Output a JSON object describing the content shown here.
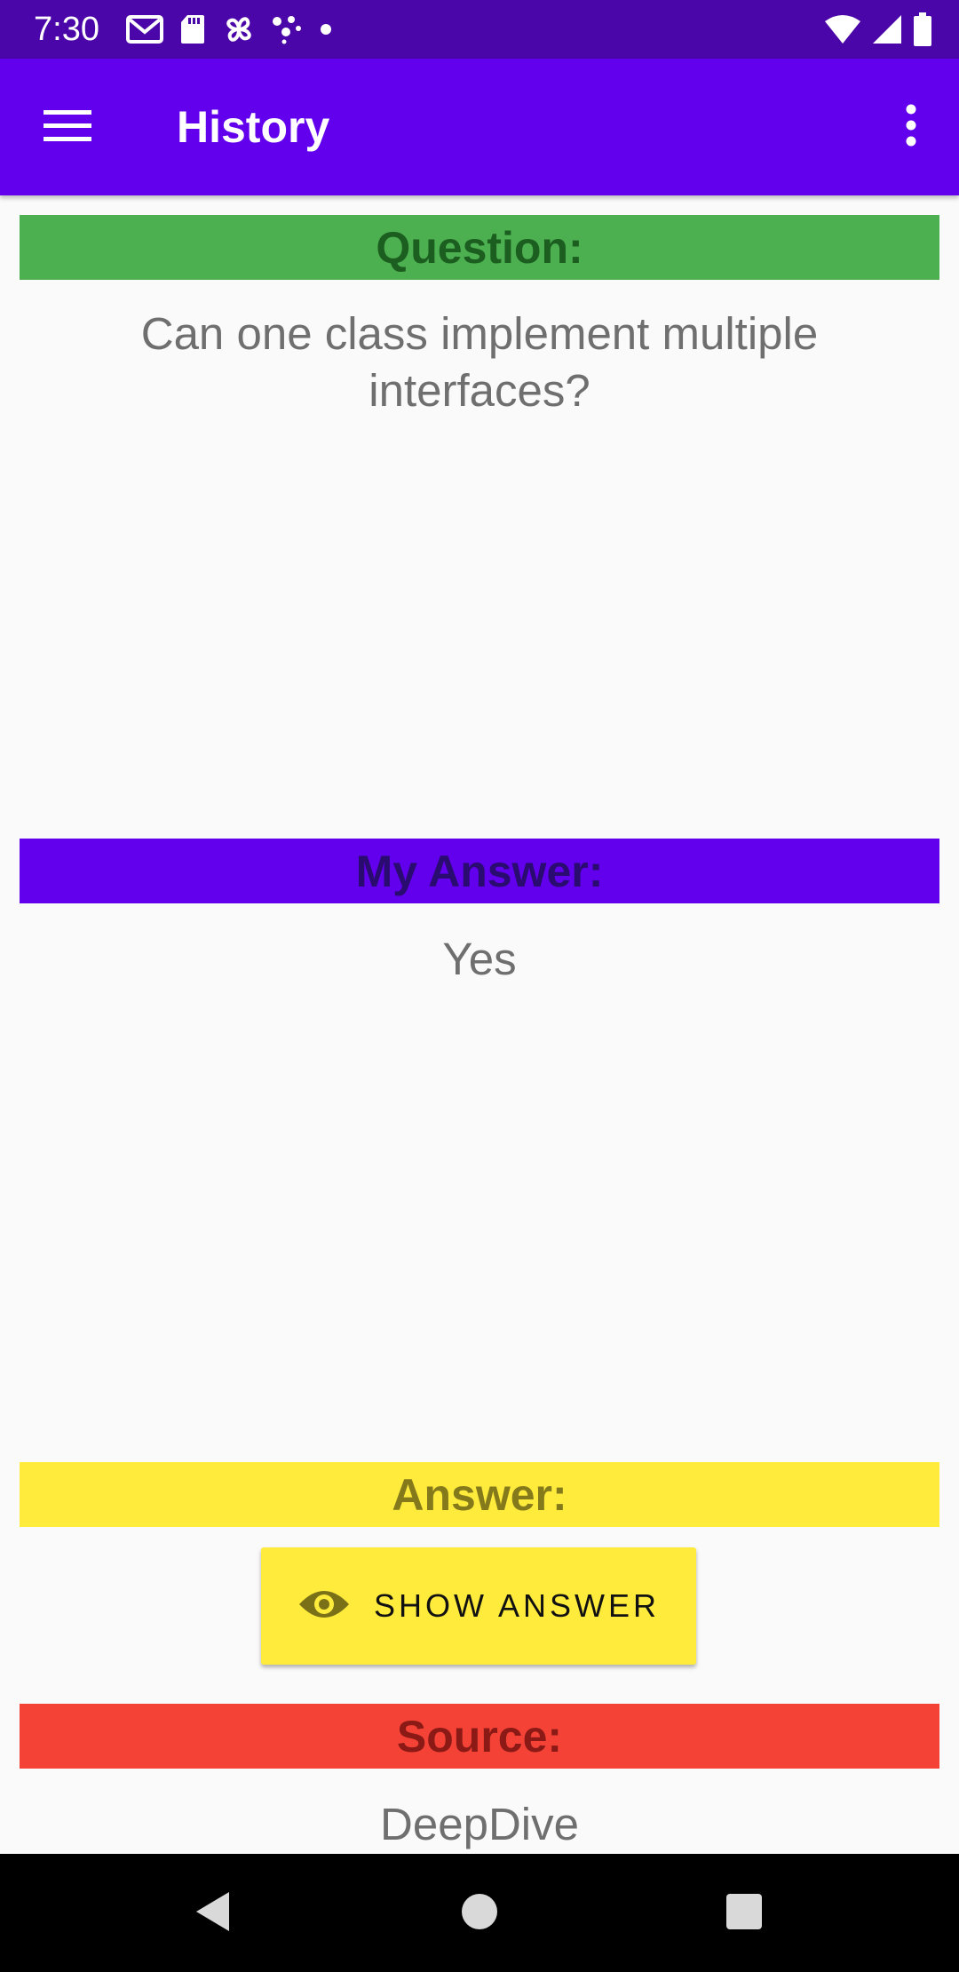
{
  "status_bar": {
    "time": "7:30",
    "left_icons": [
      "gmail-icon",
      "sd-card-icon",
      "pinwheel-icon",
      "dots-app-icon",
      "notification-dot-icon"
    ],
    "right_icons": [
      "wifi-icon",
      "signal-icon",
      "battery-icon"
    ]
  },
  "app_bar": {
    "title": "History",
    "menu_icon": "hamburger-menu-icon",
    "overflow_icon": "overflow-menu-icon",
    "color": "#6200ee"
  },
  "question": {
    "header": "Question:",
    "header_color": "#4caf50",
    "header_text_color": "#1b5e20",
    "text": "Can one class implement multiple interfaces?"
  },
  "my_answer": {
    "header": "My Answer:",
    "header_color": "#6200ee",
    "header_text_color": "#2a0b6f",
    "text": "Yes"
  },
  "answer": {
    "header": "Answer:",
    "header_color": "#ffeb3b",
    "header_text_color": "#857a1b",
    "button_label": "SHOW ANSWER",
    "button_icon": "eye-icon"
  },
  "source": {
    "header": "Source:",
    "header_color": "#f44336",
    "header_text_color": "#8b1a16",
    "text": "DeepDive"
  },
  "nav_bar": {
    "back_icon": "back-triangle-icon",
    "home_icon": "home-circle-icon",
    "recents_icon": "recents-square-icon"
  }
}
